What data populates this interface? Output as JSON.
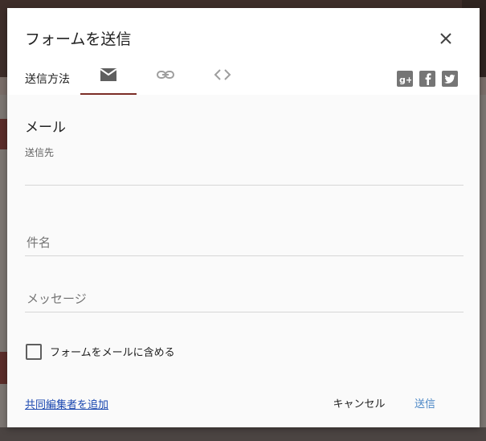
{
  "dialog": {
    "title": "フォームを送信",
    "send_via_label": "送信方法",
    "tabs": [
      {
        "icon": "mail-icon",
        "active": true
      },
      {
        "icon": "link-icon",
        "active": false
      },
      {
        "icon": "embed-code-icon",
        "active": false
      }
    ],
    "social": [
      "google-plus-icon",
      "facebook-icon",
      "twitter-icon"
    ]
  },
  "email": {
    "section_title": "メール",
    "to_label": "送信先",
    "to_value": "",
    "subject_placeholder": "件名",
    "message_placeholder": "メッセージ",
    "include_form_label": "フォームをメールに含める",
    "include_form_checked": false
  },
  "footer": {
    "add_collaborators": "共同編集者を追加",
    "cancel": "キャンセル",
    "send": "送信"
  },
  "colors": {
    "accent_underline": "#7b2d26",
    "link": "#1a47b0",
    "send_button": "#4a86c5"
  }
}
